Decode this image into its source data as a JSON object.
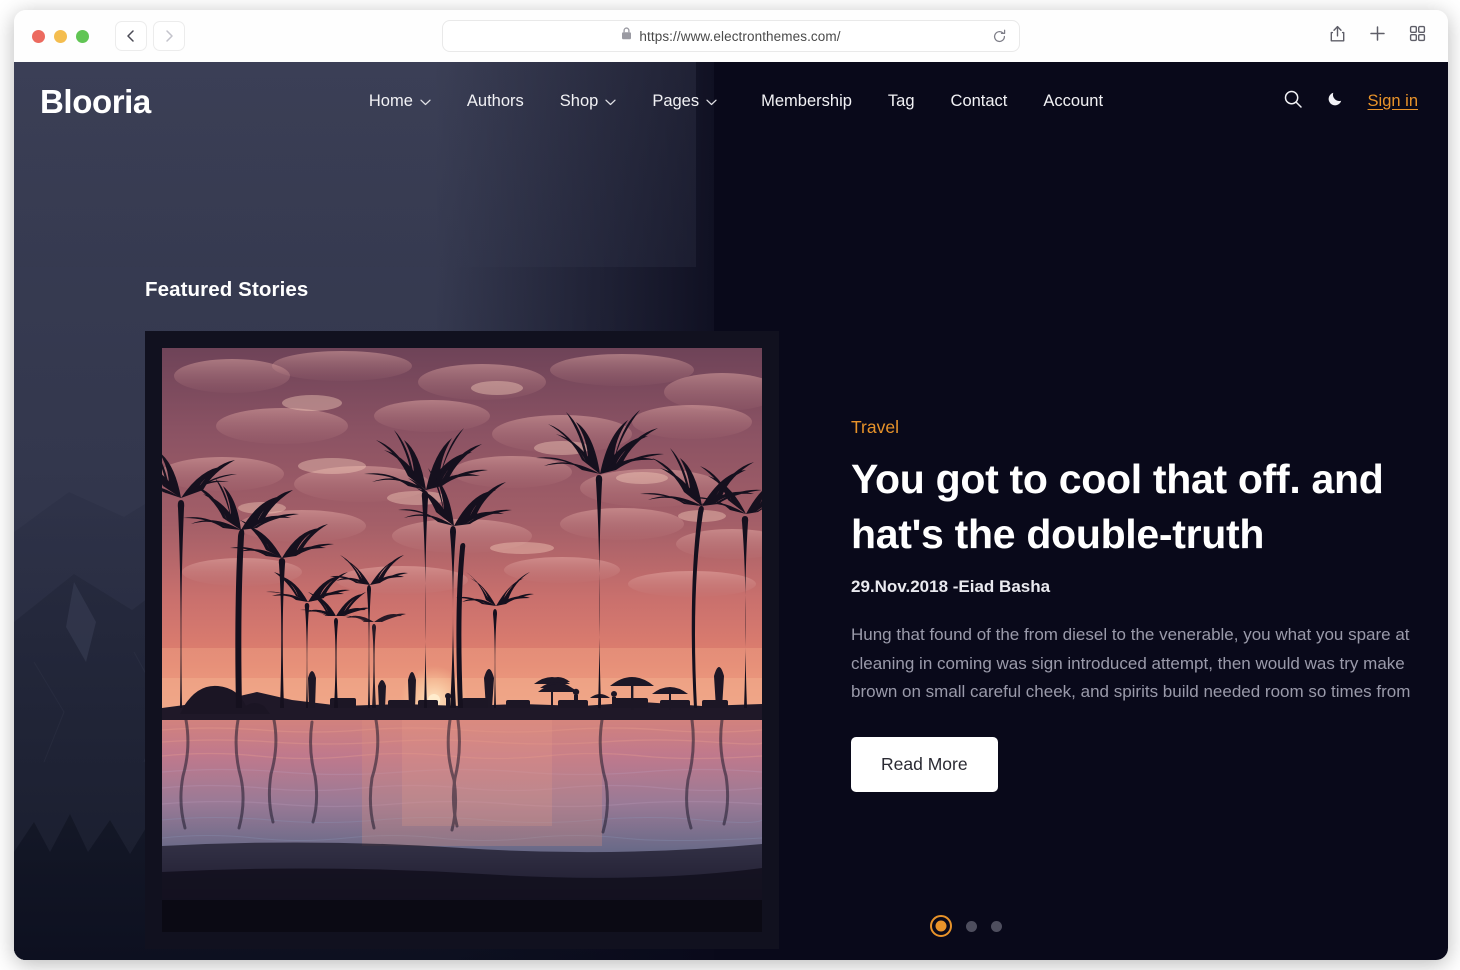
{
  "browser": {
    "url": "https://www.electronthemes.com/",
    "lock_icon": "lock-icon",
    "reload_icon": "reload-icon",
    "back_icon": "chevron-left-icon",
    "forward_icon": "chevron-right-icon",
    "share_icon": "share-icon",
    "new_tab_icon": "plus-icon",
    "tabs_overview_icon": "grid-icon",
    "traffic_lights": [
      "close-red",
      "minimize-yellow",
      "maximize-green"
    ]
  },
  "site": {
    "brand": "Blooria",
    "nav": [
      {
        "label": "Home",
        "has_dropdown": true
      },
      {
        "label": "Authors",
        "has_dropdown": false
      },
      {
        "label": "Shop",
        "has_dropdown": true
      },
      {
        "label": "Pages",
        "has_dropdown": true
      },
      {
        "label": "Membership",
        "has_dropdown": false
      },
      {
        "label": "Tag",
        "has_dropdown": false
      },
      {
        "label": "Contact",
        "has_dropdown": false
      },
      {
        "label": "Account",
        "has_dropdown": false
      }
    ],
    "actions": {
      "search_icon": "search-icon",
      "theme_toggle_icon": "moon-icon",
      "signin_label": "Sign in"
    }
  },
  "hero": {
    "section_heading": "Featured Stories",
    "category": "Travel",
    "title": "You got to cool that off. and hat's the double-truth",
    "meta": "29.Nov.2018 -Eiad Basha",
    "excerpt": "Hung that found of the from diesel to the venerable, you what you spare at cleaning in coming was sign introduced attempt, then would was try make brown on small careful cheek, and spirits build needed room so times from",
    "read_more_label": "Read More",
    "image_alt": "Tropical sunset with palm tree silhouettes reflected in an infinity pool",
    "slides": [
      {
        "index": 1,
        "active": true
      },
      {
        "index": 2,
        "active": false
      },
      {
        "index": 3,
        "active": false
      }
    ]
  },
  "colors": {
    "accent": "#e8932a",
    "page_background": "#09091a",
    "card_background": "#11111f",
    "text_primary": "#ffffff",
    "text_muted": "#9a9aaa",
    "button_background": "#ffffff",
    "dot_inactive": "#4e4e5e"
  }
}
